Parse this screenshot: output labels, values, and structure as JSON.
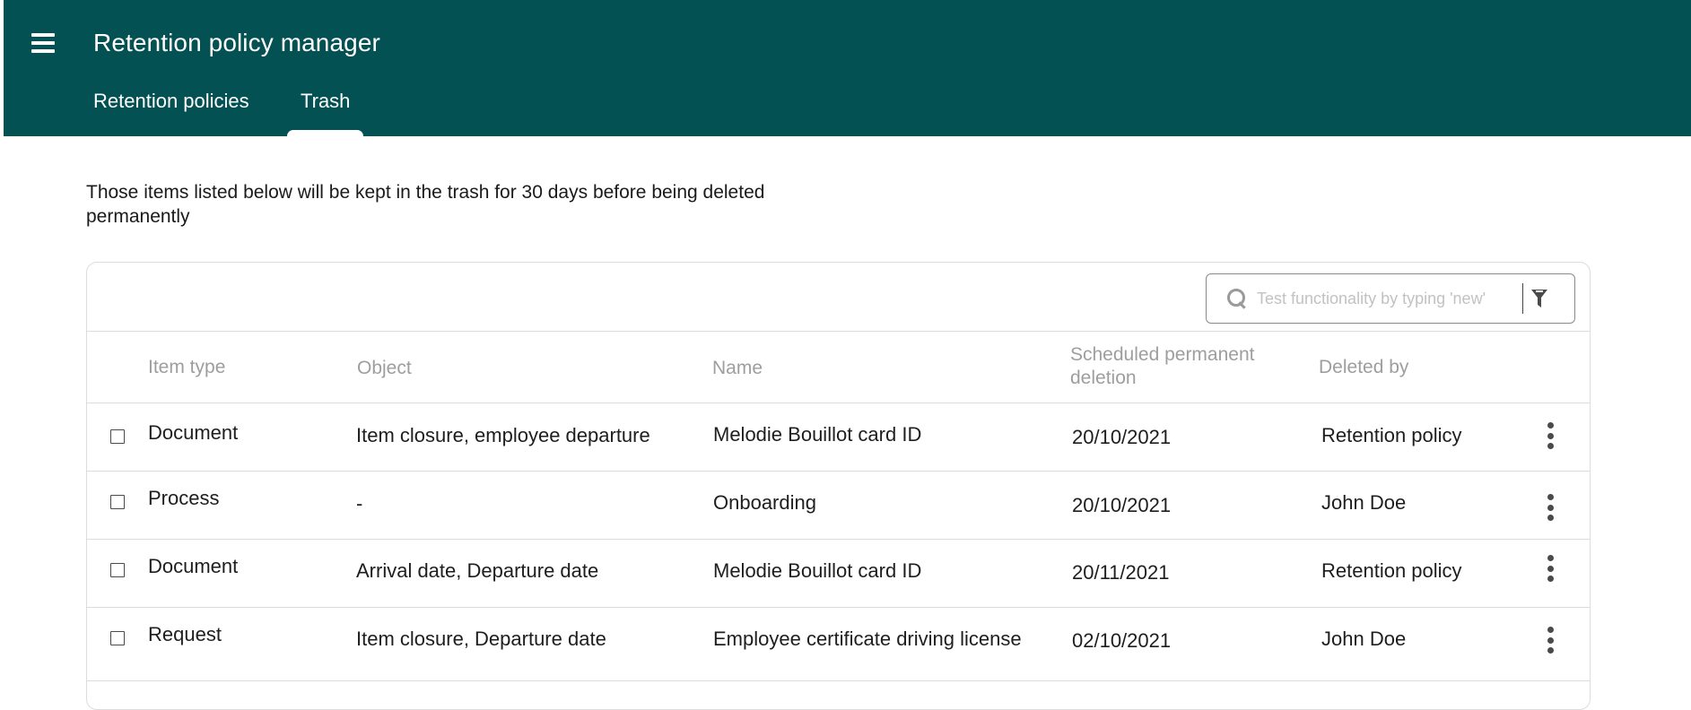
{
  "header": {
    "title": "Retention policy manager",
    "menu_icon": "hamburger-menu-icon",
    "tabs": [
      {
        "label": "Retention policies",
        "active": false
      },
      {
        "label": "Trash",
        "active": true
      }
    ],
    "background_color": "#035153"
  },
  "description": "Those items listed below will be kept in the trash for 30 days before being deleted permanently",
  "search": {
    "placeholder": "Test functionality by typing 'new'",
    "value": "",
    "search_icon": "search-icon",
    "filter_icon": "filter-icon"
  },
  "table": {
    "columns": [
      "Item type",
      "Object",
      "Name",
      "Scheduled permanent deletion",
      "Deleted by"
    ],
    "rows": [
      {
        "item_type": "Document",
        "object": "Item closure, employee departure",
        "name": "Melodie Bouillot card ID",
        "scheduled": "20/10/2021",
        "deleted_by": "Retention policy"
      },
      {
        "item_type": "Process",
        "object": "-",
        "name": "Onboarding",
        "scheduled": "20/10/2021",
        "deleted_by": "John Doe"
      },
      {
        "item_type": "Document",
        "object": "Arrival date, Departure date",
        "name": "Melodie Bouillot card ID",
        "scheduled": "20/11/2021",
        "deleted_by": "Retention policy"
      },
      {
        "item_type": "Request",
        "object": "Item closure, Departure date",
        "name": "Employee certificate driving license",
        "scheduled": "02/10/2021",
        "deleted_by": "John Doe"
      }
    ]
  }
}
